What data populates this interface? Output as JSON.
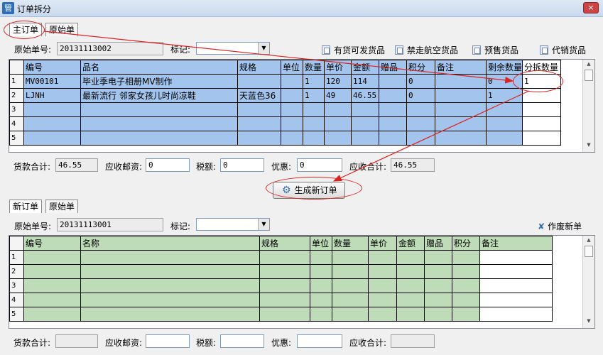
{
  "window": {
    "title": "订单拆分",
    "close_label": "×"
  },
  "top_tabs": [
    "主订单",
    "原始单"
  ],
  "top_form": {
    "orig_no_label": "原始单号:",
    "orig_no_value": "20131113002",
    "mark_label": "标记:",
    "mark_value": ""
  },
  "top_toolbar": [
    "有货可发货品",
    "禁走航空货品",
    "预售货品",
    "代销货品"
  ],
  "top_table": {
    "headers": [
      "编号",
      "品名",
      "规格",
      "单位",
      "数量",
      "单价",
      "金额",
      "赠品",
      "积分",
      "备注",
      "剩余数量",
      "分拆数量"
    ],
    "rows": [
      [
        "1",
        "MV00101",
        "毕业季电子相册MV制作",
        "",
        "",
        "1",
        "120",
        "114",
        "",
        "0",
        "",
        "0",
        "1"
      ],
      [
        "2",
        "LJNH",
        "最新流行  邻家女孩儿时尚凉鞋",
        "天蓝色36",
        "",
        "1",
        "49",
        "46.55",
        "",
        "0",
        "",
        "1",
        ""
      ],
      [
        "3",
        "",
        "",
        "",
        "",
        "",
        "",
        "",
        "",
        "",
        "",
        "",
        ""
      ],
      [
        "4",
        "",
        "",
        "",
        "",
        "",
        "",
        "",
        "",
        "",
        "",
        "",
        ""
      ],
      [
        "5",
        "",
        "",
        "",
        "",
        "",
        "",
        "",
        "",
        "",
        "",
        "",
        ""
      ]
    ]
  },
  "top_totals": {
    "goods_label": "货款合计:",
    "goods_value": "46.55",
    "postage_label": "应收邮资:",
    "postage_value": "0",
    "tax_label": "税额:",
    "tax_value": "0",
    "discount_label": "优惠:",
    "discount_value": "0",
    "receivable_label": "应收合计:",
    "receivable_value": "46.55"
  },
  "generate_button": "生成新订单",
  "bottom_tabs": [
    "新订单",
    "原始单"
  ],
  "bottom_form": {
    "orig_no_label": "原始单号:",
    "orig_no_value": "20131113001",
    "mark_label": "标记:",
    "mark_value": ""
  },
  "void_button": "作废新单",
  "bottom_table": {
    "headers": [
      "编号",
      "名称",
      "规格",
      "单位",
      "数量",
      "单价",
      "金额",
      "赠品",
      "积分",
      "备注"
    ],
    "rows": [
      [
        "1"
      ],
      [
        "2"
      ],
      [
        "3"
      ],
      [
        "4"
      ],
      [
        "5"
      ]
    ]
  },
  "bottom_totals": {
    "goods_label": "货款合计:",
    "goods_value": "",
    "postage_label": "应收邮资:",
    "postage_value": "",
    "tax_label": "税额:",
    "tax_value": "",
    "discount_label": "优惠:",
    "discount_value": "",
    "receivable_label": "应收合计:",
    "receivable_value": ""
  },
  "colors": {
    "top_grid": "#a3c4ec",
    "bottom_grid": "#bedcb8",
    "annotation": "#dd2222"
  },
  "icons": {
    "app": "app-icon",
    "toolbar": "document-icon",
    "generate": "gear-icon",
    "void": "void-document-icon"
  }
}
